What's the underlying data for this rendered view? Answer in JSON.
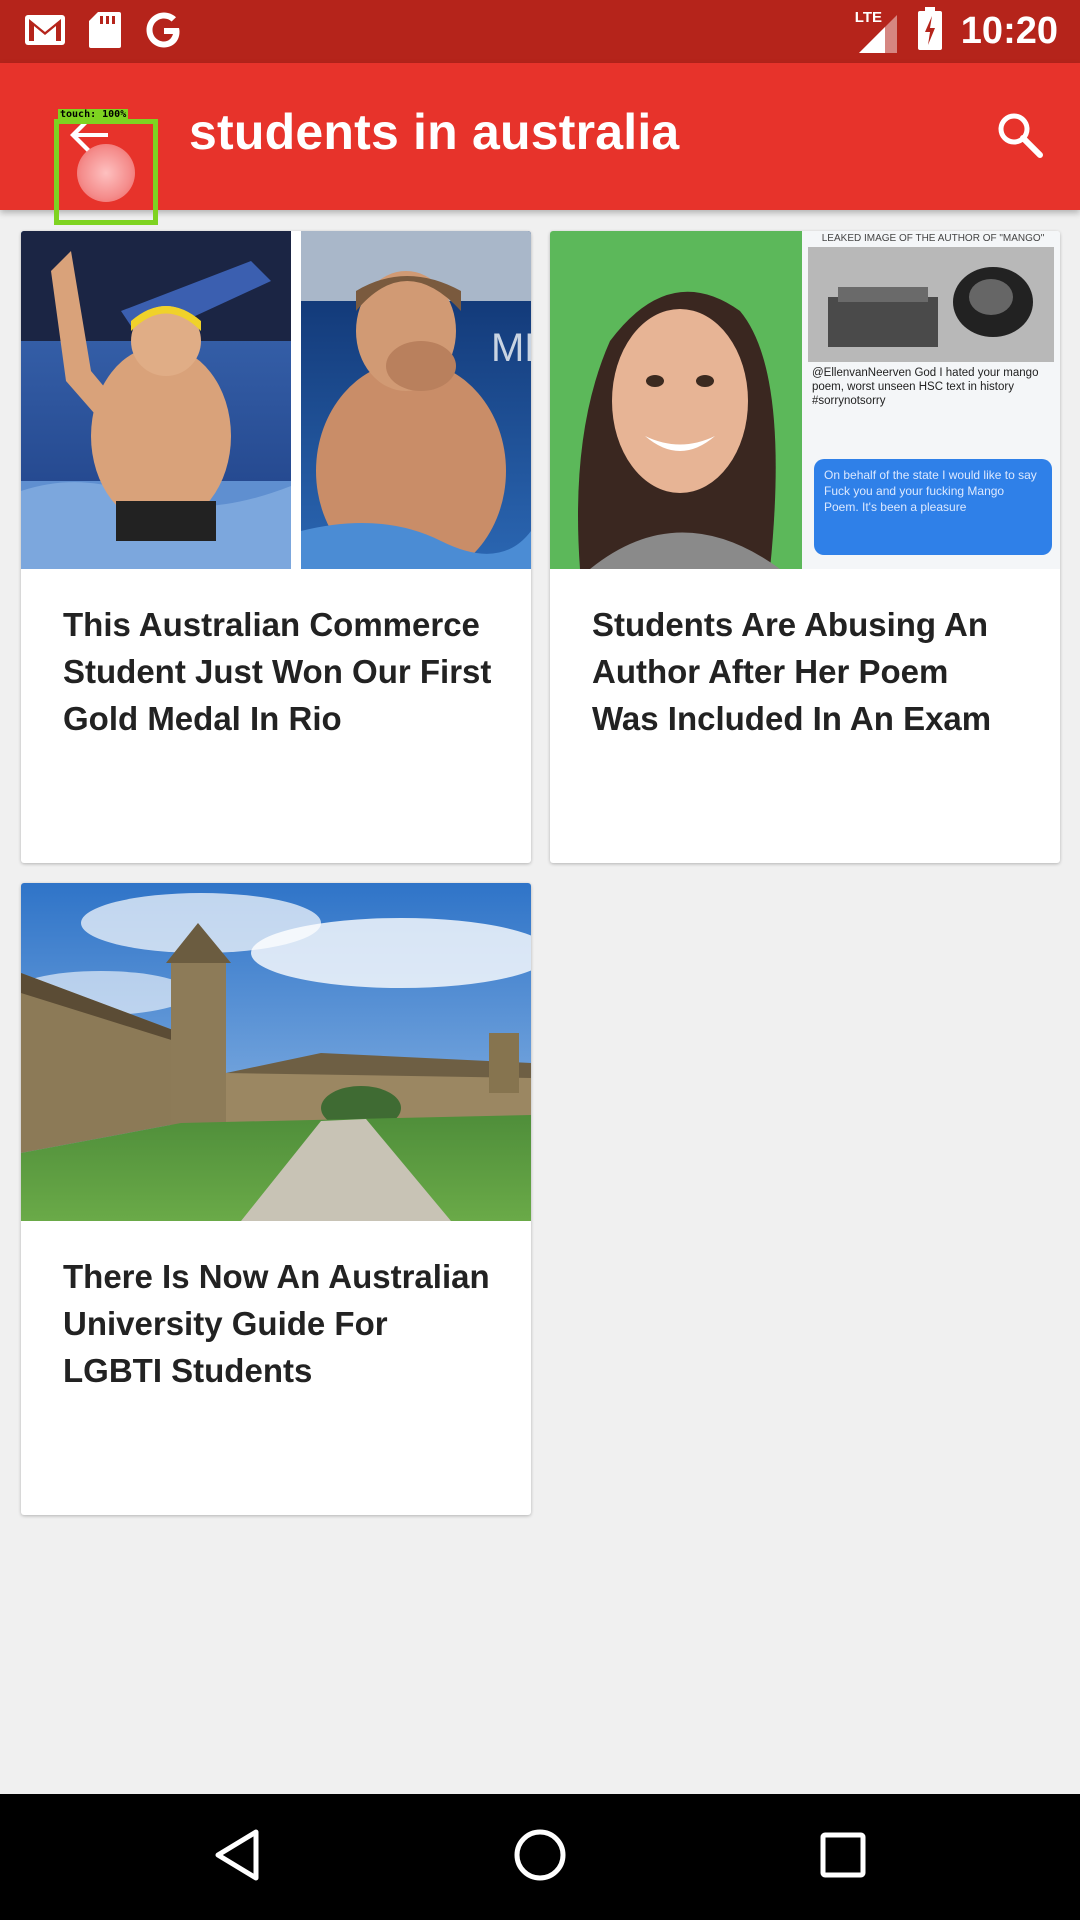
{
  "status_bar": {
    "time": "10:20",
    "network": "LTE",
    "icons": [
      "gmail-icon",
      "sd-card-icon",
      "google-icon",
      "signal-icon",
      "battery-charging-icon"
    ]
  },
  "app_bar": {
    "title": "students in australia",
    "back_icon": "arrow-back-icon",
    "search_icon": "search-icon"
  },
  "touch_overlay": {
    "label": "touch: 100%"
  },
  "articles": [
    {
      "title": "This Australian Commerce Student Just Won Our First Gold Medal In Rio",
      "image": "swimmer-photo"
    },
    {
      "title": "Students Are Abusing An Author After Her Poem Was Included In An Exam",
      "image": "author-tweet-photo",
      "image_text": {
        "header": "LEAKED IMAGE OF THE AUTHOR OF \"MANGO\"",
        "tweet": "@EllenvanNeerven God I hated your mango poem, worst unseen HSC text in history #sorrynotsorry",
        "reply": "On behalf of the state I would like to say Fuck you and your fucking Mango Poem. It's been a pleasure"
      }
    },
    {
      "title": "There Is Now An Australian University Guide For LGBTI Students",
      "image": "university-photo"
    }
  ],
  "colors": {
    "status_bar": "#b5241b",
    "app_bar": "#e7332b",
    "background": "#f0f0f0"
  },
  "nav_bar": {
    "icons": [
      "back-triangle-icon",
      "home-circle-icon",
      "recents-square-icon"
    ]
  }
}
